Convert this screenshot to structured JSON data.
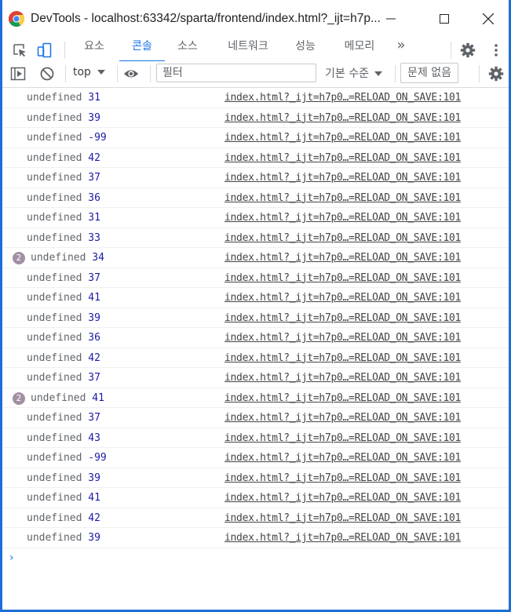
{
  "window": {
    "title": "DevTools - localhost:63342/sparta/frontend/index.html?_ijt=h7p...",
    "icons": {
      "app": "chrome-logo",
      "minimize": "minimize-icon",
      "maximize": "maximize-icon",
      "close": "close-icon"
    }
  },
  "tabs": {
    "items": [
      {
        "label": "요소",
        "active": false
      },
      {
        "label": "콘솔",
        "active": true
      },
      {
        "label": "소스",
        "active": false
      },
      {
        "label": "네트워크",
        "active": false
      },
      {
        "label": "성능",
        "active": false
      },
      {
        "label": "메모리",
        "active": false
      }
    ],
    "more": "»",
    "icons": [
      "inspect-element-icon",
      "device-toolbar-icon",
      "more-tabs-icon",
      "settings-icon",
      "kebab-menu-icon"
    ]
  },
  "toolbar": {
    "context": "top",
    "filter_placeholder": "필터",
    "levels": "기본 수준",
    "issues": "문제 없음",
    "icons": [
      "sidebar-toggle-icon",
      "clear-console-icon",
      "chevron-down-icon",
      "eye-icon",
      "console-settings-icon"
    ]
  },
  "messages": [
    {
      "count": "",
      "text": "undefined",
      "value": "31",
      "source": "index.html?_ijt=h7p0…=RELOAD_ON_SAVE:101"
    },
    {
      "count": "",
      "text": "undefined",
      "value": "39",
      "source": "index.html?_ijt=h7p0…=RELOAD_ON_SAVE:101"
    },
    {
      "count": "",
      "text": "undefined",
      "value": "-99",
      "source": "index.html?_ijt=h7p0…=RELOAD_ON_SAVE:101"
    },
    {
      "count": "",
      "text": "undefined",
      "value": "42",
      "source": "index.html?_ijt=h7p0…=RELOAD_ON_SAVE:101"
    },
    {
      "count": "",
      "text": "undefined",
      "value": "37",
      "source": "index.html?_ijt=h7p0…=RELOAD_ON_SAVE:101"
    },
    {
      "count": "",
      "text": "undefined",
      "value": "36",
      "source": "index.html?_ijt=h7p0…=RELOAD_ON_SAVE:101"
    },
    {
      "count": "",
      "text": "undefined",
      "value": "31",
      "source": "index.html?_ijt=h7p0…=RELOAD_ON_SAVE:101"
    },
    {
      "count": "",
      "text": "undefined",
      "value": "33",
      "source": "index.html?_ijt=h7p0…=RELOAD_ON_SAVE:101"
    },
    {
      "count": "2",
      "text": "undefined",
      "value": "34",
      "source": "index.html?_ijt=h7p0…=RELOAD_ON_SAVE:101"
    },
    {
      "count": "",
      "text": "undefined",
      "value": "37",
      "source": "index.html?_ijt=h7p0…=RELOAD_ON_SAVE:101"
    },
    {
      "count": "",
      "text": "undefined",
      "value": "41",
      "source": "index.html?_ijt=h7p0…=RELOAD_ON_SAVE:101"
    },
    {
      "count": "",
      "text": "undefined",
      "value": "39",
      "source": "index.html?_ijt=h7p0…=RELOAD_ON_SAVE:101"
    },
    {
      "count": "",
      "text": "undefined",
      "value": "36",
      "source": "index.html?_ijt=h7p0…=RELOAD_ON_SAVE:101"
    },
    {
      "count": "",
      "text": "undefined",
      "value": "42",
      "source": "index.html?_ijt=h7p0…=RELOAD_ON_SAVE:101"
    },
    {
      "count": "",
      "text": "undefined",
      "value": "37",
      "source": "index.html?_ijt=h7p0…=RELOAD_ON_SAVE:101"
    },
    {
      "count": "2",
      "text": "undefined",
      "value": "41",
      "source": "index.html?_ijt=h7p0…=RELOAD_ON_SAVE:101"
    },
    {
      "count": "",
      "text": "undefined",
      "value": "37",
      "source": "index.html?_ijt=h7p0…=RELOAD_ON_SAVE:101"
    },
    {
      "count": "",
      "text": "undefined",
      "value": "43",
      "source": "index.html?_ijt=h7p0…=RELOAD_ON_SAVE:101"
    },
    {
      "count": "",
      "text": "undefined",
      "value": "-99",
      "source": "index.html?_ijt=h7p0…=RELOAD_ON_SAVE:101"
    },
    {
      "count": "",
      "text": "undefined",
      "value": "39",
      "source": "index.html?_ijt=h7p0…=RELOAD_ON_SAVE:101"
    },
    {
      "count": "",
      "text": "undefined",
      "value": "41",
      "source": "index.html?_ijt=h7p0…=RELOAD_ON_SAVE:101"
    },
    {
      "count": "",
      "text": "undefined",
      "value": "42",
      "source": "index.html?_ijt=h7p0…=RELOAD_ON_SAVE:101"
    },
    {
      "count": "",
      "text": "undefined",
      "value": "39",
      "source": "index.html?_ijt=h7p0…=RELOAD_ON_SAVE:101"
    }
  ],
  "prompt": "›",
  "colors": {
    "accent": "#1a73e8",
    "number": "#1a1aa6",
    "badge": "#a28fa3",
    "window_border": "#1d6fd8"
  }
}
